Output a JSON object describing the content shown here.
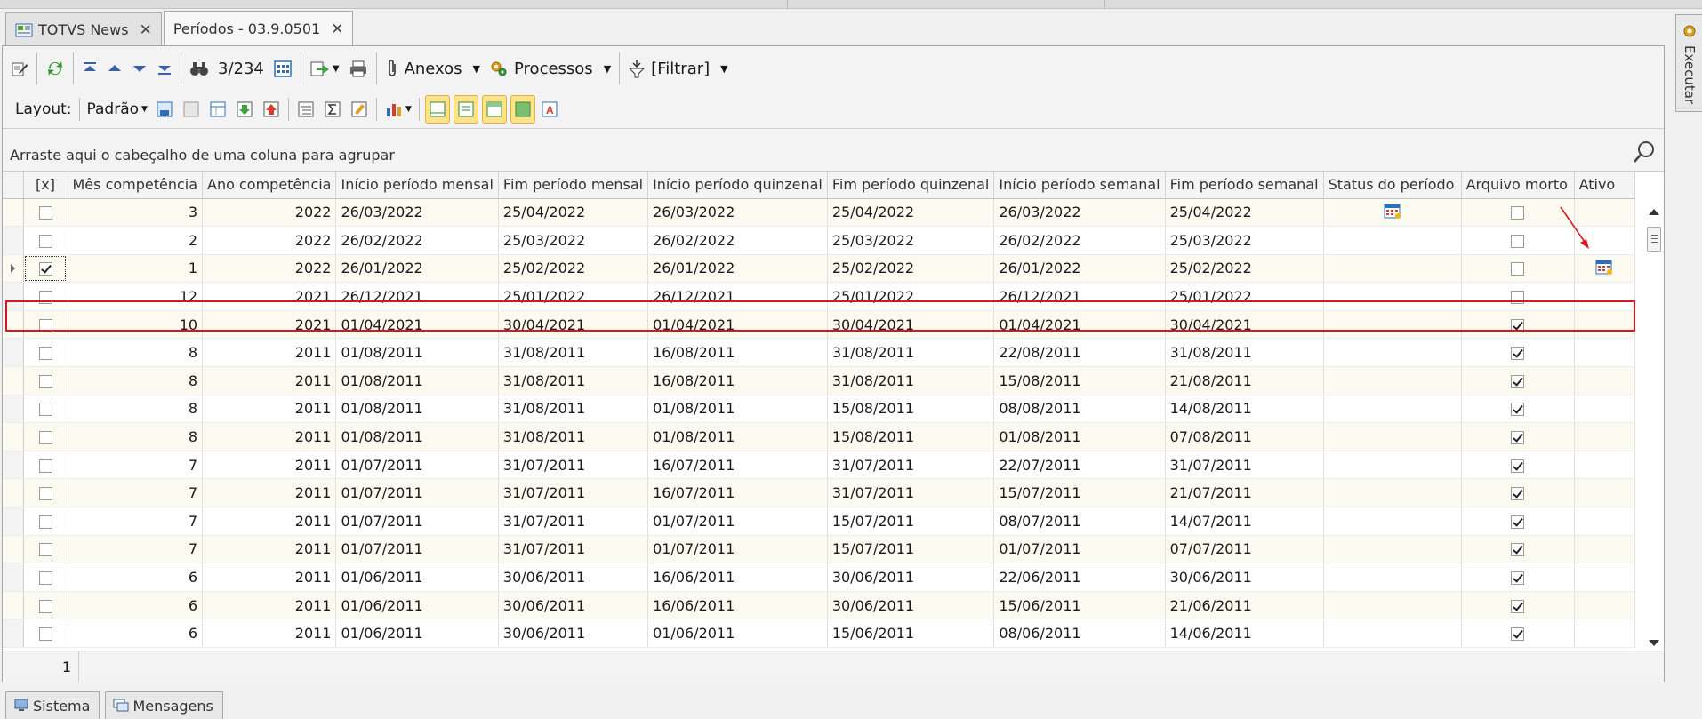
{
  "tabs": [
    {
      "label": "TOTVS News",
      "active": false
    },
    {
      "label": "Períodos - 03.9.0501",
      "active": true
    }
  ],
  "toolbar": {
    "record_counter": "3/234",
    "anexos_label": "Anexos",
    "processos_label": "Processos",
    "filtrar_label": "[Filtrar]"
  },
  "layout_bar": {
    "layout_label": "Layout:",
    "layout_value": "Padrão"
  },
  "group_panel": {
    "text": "Arraste aqui o cabeçalho de uma coluna para agrupar"
  },
  "grid": {
    "columns": [
      "[x]",
      "Mês competência",
      "Ano competência",
      "Início período mensal",
      "Fim período mensal",
      "Início período quinzenal",
      "Fim período quinzenal",
      "Início período semanal",
      "Fim período semanal",
      "Status do período",
      "Arquivo morto",
      "Ativo"
    ],
    "rows": [
      {
        "sel": false,
        "mes": "3",
        "ano": "2022",
        "ini_m": "26/03/2022",
        "fim_m": "25/04/2022",
        "ini_q": "26/03/2022",
        "fim_q": "25/04/2022",
        "ini_s": "26/03/2022",
        "fim_s": "25/04/2022",
        "status_icon": true,
        "arquivo": false,
        "ativo_icon": false
      },
      {
        "sel": false,
        "mes": "2",
        "ano": "2022",
        "ini_m": "26/02/2022",
        "fim_m": "25/03/2022",
        "ini_q": "26/02/2022",
        "fim_q": "25/03/2022",
        "ini_s": "26/02/2022",
        "fim_s": "25/03/2022",
        "status_icon": false,
        "arquivo": false,
        "ativo_icon": false
      },
      {
        "sel": true,
        "mes": "1",
        "ano": "2022",
        "ini_m": "26/01/2022",
        "fim_m": "25/02/2022",
        "ini_q": "26/01/2022",
        "fim_q": "25/02/2022",
        "ini_s": "26/01/2022",
        "fim_s": "25/02/2022",
        "status_icon": false,
        "arquivo": false,
        "ativo_icon": true,
        "current": true
      },
      {
        "sel": false,
        "mes": "12",
        "ano": "2021",
        "ini_m": "26/12/2021",
        "fim_m": "25/01/2022",
        "ini_q": "26/12/2021",
        "fim_q": "25/01/2022",
        "ini_s": "26/12/2021",
        "fim_s": "25/01/2022",
        "status_icon": false,
        "arquivo": false,
        "ativo_icon": false
      },
      {
        "sel": false,
        "mes": "10",
        "ano": "2021",
        "ini_m": "01/04/2021",
        "fim_m": "30/04/2021",
        "ini_q": "01/04/2021",
        "fim_q": "30/04/2021",
        "ini_s": "01/04/2021",
        "fim_s": "30/04/2021",
        "status_icon": false,
        "arquivo": true,
        "ativo_icon": false
      },
      {
        "sel": false,
        "mes": "8",
        "ano": "2011",
        "ini_m": "01/08/2011",
        "fim_m": "31/08/2011",
        "ini_q": "16/08/2011",
        "fim_q": "31/08/2011",
        "ini_s": "22/08/2011",
        "fim_s": "31/08/2011",
        "status_icon": false,
        "arquivo": true,
        "ativo_icon": false
      },
      {
        "sel": false,
        "mes": "8",
        "ano": "2011",
        "ini_m": "01/08/2011",
        "fim_m": "31/08/2011",
        "ini_q": "16/08/2011",
        "fim_q": "31/08/2011",
        "ini_s": "15/08/2011",
        "fim_s": "21/08/2011",
        "status_icon": false,
        "arquivo": true,
        "ativo_icon": false
      },
      {
        "sel": false,
        "mes": "8",
        "ano": "2011",
        "ini_m": "01/08/2011",
        "fim_m": "31/08/2011",
        "ini_q": "01/08/2011",
        "fim_q": "15/08/2011",
        "ini_s": "08/08/2011",
        "fim_s": "14/08/2011",
        "status_icon": false,
        "arquivo": true,
        "ativo_icon": false
      },
      {
        "sel": false,
        "mes": "8",
        "ano": "2011",
        "ini_m": "01/08/2011",
        "fim_m": "31/08/2011",
        "ini_q": "01/08/2011",
        "fim_q": "15/08/2011",
        "ini_s": "01/08/2011",
        "fim_s": "07/08/2011",
        "status_icon": false,
        "arquivo": true,
        "ativo_icon": false
      },
      {
        "sel": false,
        "mes": "7",
        "ano": "2011",
        "ini_m": "01/07/2011",
        "fim_m": "31/07/2011",
        "ini_q": "16/07/2011",
        "fim_q": "31/07/2011",
        "ini_s": "22/07/2011",
        "fim_s": "31/07/2011",
        "status_icon": false,
        "arquivo": true,
        "ativo_icon": false
      },
      {
        "sel": false,
        "mes": "7",
        "ano": "2011",
        "ini_m": "01/07/2011",
        "fim_m": "31/07/2011",
        "ini_q": "16/07/2011",
        "fim_q": "31/07/2011",
        "ini_s": "15/07/2011",
        "fim_s": "21/07/2011",
        "status_icon": false,
        "arquivo": true,
        "ativo_icon": false
      },
      {
        "sel": false,
        "mes": "7",
        "ano": "2011",
        "ini_m": "01/07/2011",
        "fim_m": "31/07/2011",
        "ini_q": "01/07/2011",
        "fim_q": "15/07/2011",
        "ini_s": "08/07/2011",
        "fim_s": "14/07/2011",
        "status_icon": false,
        "arquivo": true,
        "ativo_icon": false
      },
      {
        "sel": false,
        "mes": "7",
        "ano": "2011",
        "ini_m": "01/07/2011",
        "fim_m": "31/07/2011",
        "ini_q": "01/07/2011",
        "fim_q": "15/07/2011",
        "ini_s": "01/07/2011",
        "fim_s": "07/07/2011",
        "status_icon": false,
        "arquivo": true,
        "ativo_icon": false
      },
      {
        "sel": false,
        "mes": "6",
        "ano": "2011",
        "ini_m": "01/06/2011",
        "fim_m": "30/06/2011",
        "ini_q": "16/06/2011",
        "fim_q": "30/06/2011",
        "ini_s": "22/06/2011",
        "fim_s": "30/06/2011",
        "status_icon": false,
        "arquivo": true,
        "ativo_icon": false
      },
      {
        "sel": false,
        "mes": "6",
        "ano": "2011",
        "ini_m": "01/06/2011",
        "fim_m": "30/06/2011",
        "ini_q": "16/06/2011",
        "fim_q": "30/06/2011",
        "ini_s": "15/06/2011",
        "fim_s": "21/06/2011",
        "status_icon": false,
        "arquivo": true,
        "ativo_icon": false
      },
      {
        "sel": false,
        "mes": "6",
        "ano": "2011",
        "ini_m": "01/06/2011",
        "fim_m": "30/06/2011",
        "ini_q": "01/06/2011",
        "fim_q": "15/06/2011",
        "ini_s": "08/06/2011",
        "fim_s": "14/06/2011",
        "status_icon": false,
        "arquivo": true,
        "ativo_icon": false
      }
    ]
  },
  "footer": {
    "count": "1"
  },
  "bottom_tabs": [
    "Sistema",
    "Mensagens"
  ],
  "sidebar": {
    "label": "Executar"
  },
  "colors": {
    "annotation": "#d9161c",
    "highlight_button": "#fde48a",
    "row_alt": "#fafaf1"
  }
}
